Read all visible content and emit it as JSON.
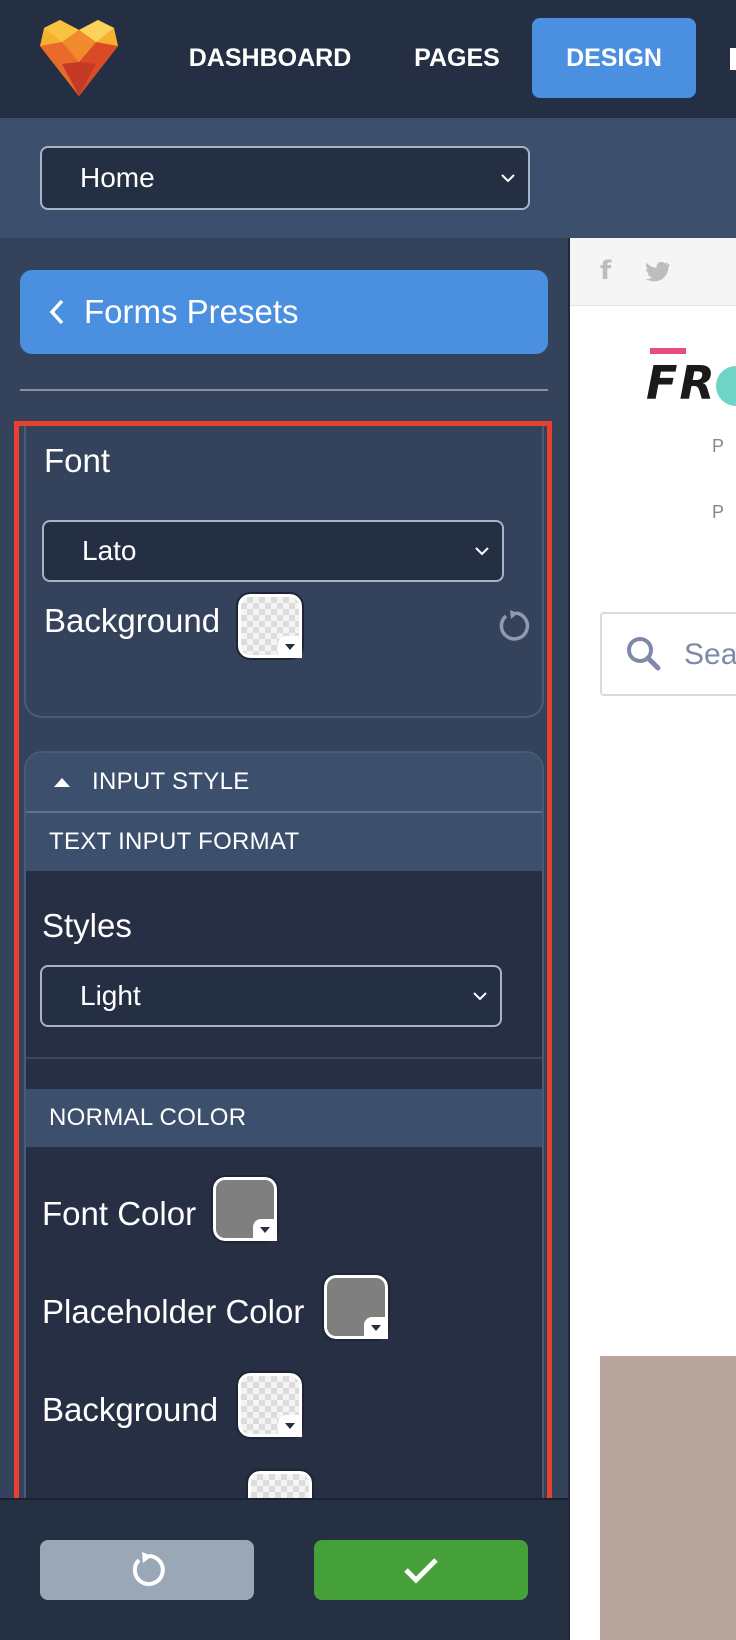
{
  "nav": {
    "items": [
      "DASHBOARD",
      "PAGES",
      "DESIGN"
    ],
    "active": "DESIGN"
  },
  "page_select": {
    "value": "Home"
  },
  "sidebar": {
    "back_label": "Forms Presets",
    "font_label": "Font",
    "font_value": "Lato",
    "background_label": "Background",
    "input_style_label": "INPUT STYLE",
    "text_input_format_label": "TEXT INPUT FORMAT",
    "styles_label": "Styles",
    "styles_value": "Light",
    "normal_color_label": "NORMAL COLOR",
    "font_color_label": "Font Color",
    "placeholder_color_label": "Placeholder Color",
    "background2_label": "Background"
  },
  "colors": {
    "accent": "#4a8fe0",
    "apply": "#46a03a",
    "reset": "#9aa7b6",
    "highlight_border": "#e8402d",
    "font_color_swatch": "#7f7f7f",
    "placeholder_color_swatch": "#7f7f7f"
  },
  "icons": [
    "logo-icon",
    "chevron-down-icon",
    "chevron-left-icon",
    "reset-icon",
    "check-icon",
    "facebook-icon",
    "twitter-icon",
    "search-icon"
  ],
  "preview": {
    "logo_text": "FR",
    "p1": "P",
    "p2": "P",
    "search_placeholder": "Sea"
  }
}
